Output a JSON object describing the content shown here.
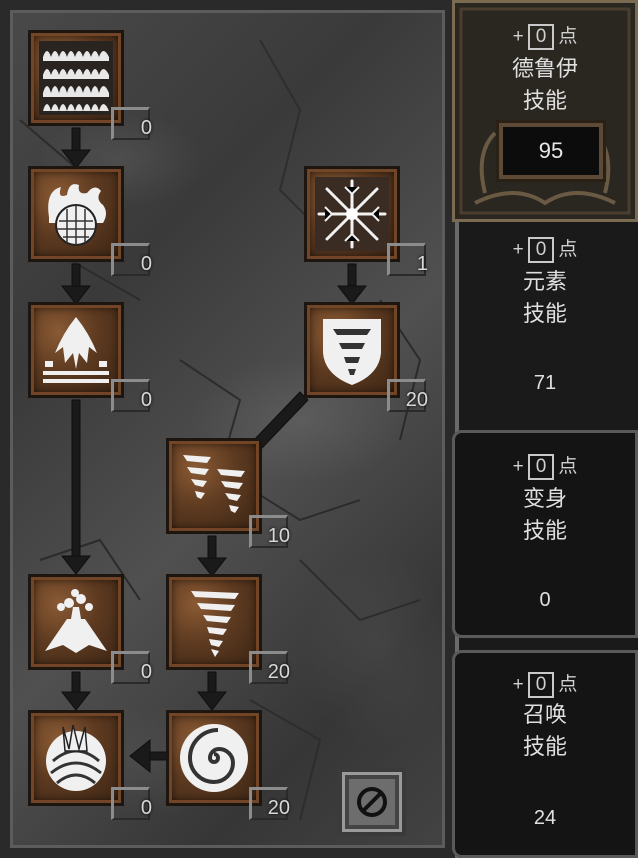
{
  "skills": [
    {
      "id": "firestorm",
      "icon": "fire-rows-icon",
      "level": "0"
    },
    {
      "id": "molten-boulder",
      "icon": "flaming-boulder-icon",
      "level": "0"
    },
    {
      "id": "arctic-blast",
      "icon": "ice-star-icon",
      "level": "1"
    },
    {
      "id": "fissure",
      "icon": "fissure-icon",
      "level": "0"
    },
    {
      "id": "cyclone-armor",
      "icon": "tornado-shield-icon",
      "level": "20"
    },
    {
      "id": "twister",
      "icon": "twin-twister-icon",
      "level": "10"
    },
    {
      "id": "volcano",
      "icon": "volcano-icon",
      "level": "0"
    },
    {
      "id": "tornado",
      "icon": "tornado-icon",
      "level": "20"
    },
    {
      "id": "armageddon",
      "icon": "armageddon-icon",
      "level": "0"
    },
    {
      "id": "hurricane",
      "icon": "spiral-icon",
      "level": "20"
    }
  ],
  "panels": {
    "druid": {
      "plus": "+",
      "points": "0",
      "unit": "点",
      "line1": "德鲁伊",
      "line2": "技能",
      "total": "95"
    },
    "elemental": {
      "plus": "+",
      "points": "0",
      "unit": "点",
      "line1": "元素",
      "line2": "技能",
      "value": "71"
    },
    "shapeshift": {
      "plus": "+",
      "points": "0",
      "unit": "点",
      "line1": "变身",
      "line2": "技能",
      "value": "0"
    },
    "summon": {
      "plus": "+",
      "points": "0",
      "unit": "点",
      "line1": "召唤",
      "line2": "技能",
      "value": "24"
    }
  },
  "colors": {
    "frame": "#704626",
    "stone": "#444444",
    "text": "#e0e0e0"
  }
}
